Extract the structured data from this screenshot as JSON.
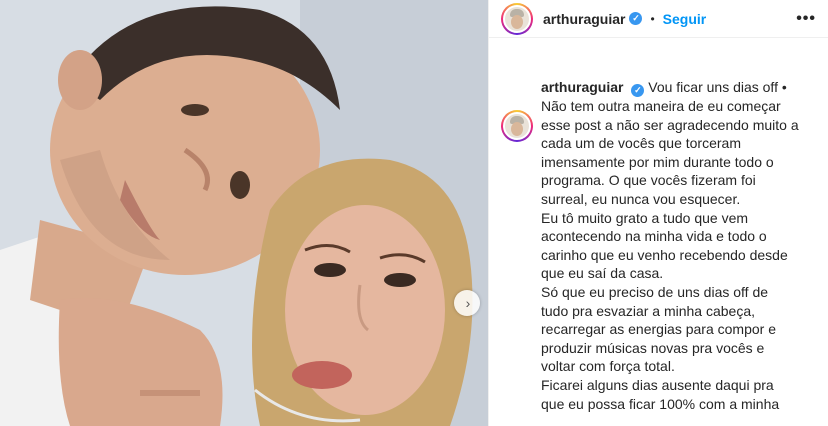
{
  "post": {
    "username": "arthuraguiar",
    "follow_label": "Seguir",
    "separator": "•",
    "more_label": "•••",
    "verified_mark": "✓",
    "carousel_next_icon": "chevron-right-icon",
    "caption_lines": [
      "Vou ficar uns dias off •",
      "Não tem outra maneira de eu começar",
      "esse post a não ser agradecendo muito a",
      "cada um de vocês que torceram",
      "imensamente por mim durante todo o",
      "programa. O que vocês fizeram foi",
      "surreal, eu nunca vou esquecer.",
      "Eu tô muito grato a tudo que vem",
      "acontecendo na minha vida e todo o",
      "carinho que eu venho recebendo desde",
      "que eu saí da casa.",
      "Só que eu preciso de uns dias off de",
      "tudo pra esvaziar a minha cabeça,",
      "recarregar as energias para compor e",
      "produzir músicas novas pra vocês e",
      "voltar com força total.",
      "Ficarei alguns dias ausente daqui pra",
      "que eu possa ficar 100% com a minha"
    ]
  },
  "colors": {
    "follow": "#0095f6",
    "verified": "#3897f0",
    "text": "#262626"
  }
}
